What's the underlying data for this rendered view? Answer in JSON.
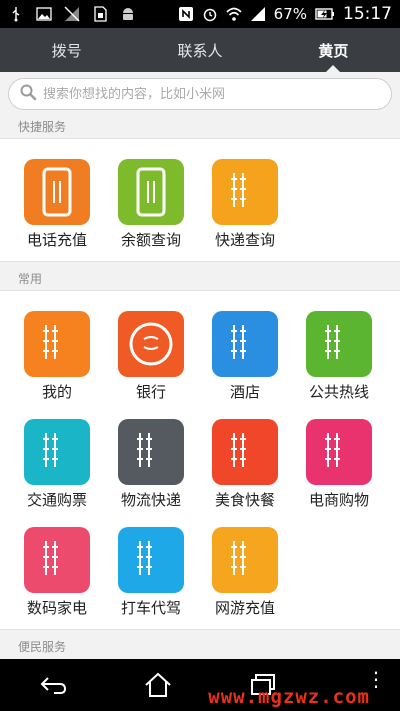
{
  "status_bar": {
    "battery": "67%",
    "time": "15:17"
  },
  "tabs": [
    {
      "label": "拨号"
    },
    {
      "label": "联系人"
    },
    {
      "label": "黄页"
    }
  ],
  "active_tab": 2,
  "search": {
    "placeholder": "搜索你想找的内容，比如小米网"
  },
  "sections": {
    "quick": {
      "title": "快捷服务",
      "items": [
        {
          "label": "电话充值",
          "icon": "phone-topup-icon",
          "color": "#f07d22"
        },
        {
          "label": "余额查询",
          "icon": "balance-icon",
          "color": "#7dbb2c"
        },
        {
          "label": "快递查询",
          "icon": "express-icon",
          "color": "#f5a31c"
        }
      ]
    },
    "common": {
      "title": "常用",
      "items": [
        {
          "label": "我的",
          "icon": "mine-icon",
          "color": "#f5821f"
        },
        {
          "label": "银行",
          "icon": "bank-icon",
          "color": "#f05a24"
        },
        {
          "label": "酒店",
          "icon": "hotel-icon",
          "color": "#2a8fe0"
        },
        {
          "label": "公共热线",
          "icon": "hotline-icon",
          "color": "#5cb531"
        },
        {
          "label": "交通购票",
          "icon": "ticket-icon",
          "color": "#1ab6c8"
        },
        {
          "label": "物流快递",
          "icon": "logistics-icon",
          "color": "#555a60"
        },
        {
          "label": "美食快餐",
          "icon": "food-icon",
          "color": "#f0472a"
        },
        {
          "label": "电商购物",
          "icon": "shopping-icon",
          "color": "#e8336f"
        },
        {
          "label": "数码家电",
          "icon": "digital-icon",
          "color": "#ec4b6e"
        },
        {
          "label": "打车代驾",
          "icon": "taxi-icon",
          "color": "#1ea8e8"
        },
        {
          "label": "网游充值",
          "icon": "game-icon",
          "color": "#f6a51e"
        }
      ]
    },
    "civil": {
      "title": "便民服务"
    }
  },
  "watermark": "www.mgzwz.com"
}
